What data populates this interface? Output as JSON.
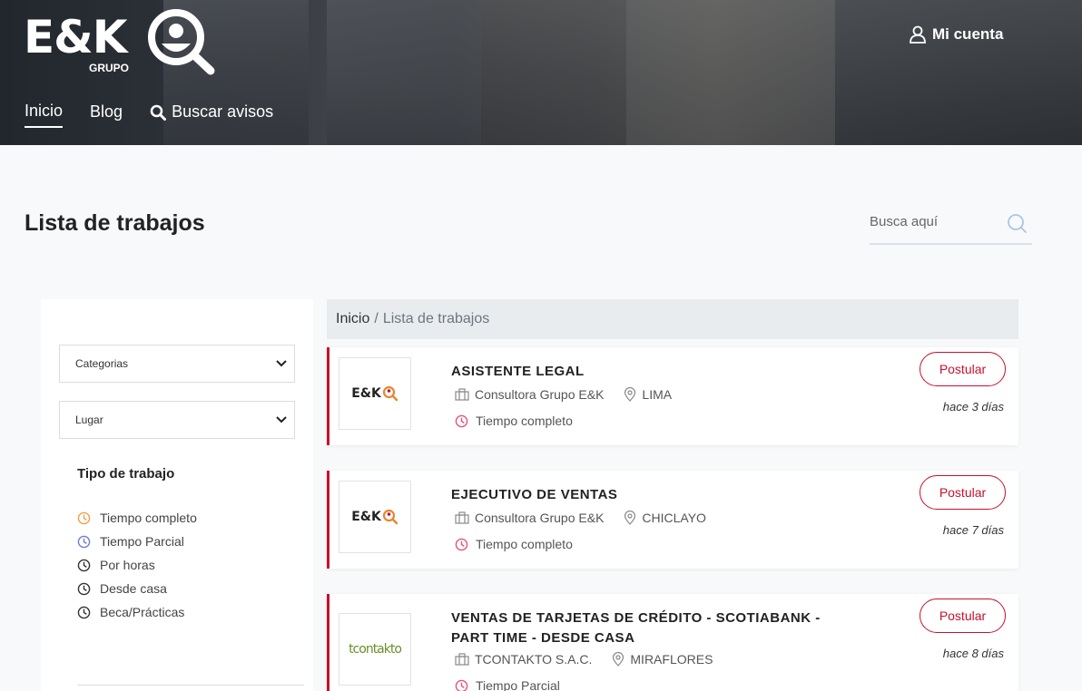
{
  "header": {
    "logo_text": "E&K",
    "logo_sub": "GRUPO",
    "account_label": "Mi cuenta",
    "nav": [
      {
        "label": "Inicio"
      },
      {
        "label": "Blog"
      },
      {
        "label": "Buscar avisos"
      }
    ]
  },
  "page": {
    "title": "Lista de trabajos",
    "search_placeholder": "Busca aquí"
  },
  "sidebar": {
    "category_select": "Categorias",
    "location_select": "Lugar",
    "job_type_title": "Tipo de trabajo",
    "job_types": [
      {
        "label": "Tiempo completo",
        "color": "#f0a04b"
      },
      {
        "label": "Tiempo Parcial",
        "color": "#6f7bd9"
      },
      {
        "label": "Por horas",
        "color": "#333333"
      },
      {
        "label": "Desde casa",
        "color": "#333333"
      },
      {
        "label": "Beca/Prácticas",
        "color": "#333333"
      }
    ]
  },
  "breadcrumb": {
    "home": "Inicio",
    "separator": "/",
    "current": "Lista de trabajos"
  },
  "jobs": [
    {
      "title": "ASISTENTE LEGAL",
      "company": "Consultora Grupo E&K",
      "location": "LIMA",
      "type": "Tiempo completo",
      "date": "hace 3 días",
      "apply_label": "Postular",
      "logo_text": "E&K"
    },
    {
      "title": "EJECUTIVO DE VENTAS",
      "company": "Consultora Grupo E&K",
      "location": "CHICLAYO",
      "type": "Tiempo completo",
      "date": "hace 7 días",
      "apply_label": "Postular",
      "logo_text": "E&K"
    },
    {
      "title": "VENTAS DE TARJETAS DE CRÉDITO - SCOTIABANK - PART TIME - DESDE CASA",
      "company": "TCONTAKTO S.A.C.",
      "location": "MIRAFLORES",
      "type": "Tiempo Parcial",
      "date": "hace 8 días",
      "apply_label": "Postular",
      "logo_text": "tcontakto"
    }
  ],
  "colors": {
    "accent": "#c8102e",
    "clock_full_time": "#e8527a",
    "search_icon": "#a9c6e6"
  }
}
